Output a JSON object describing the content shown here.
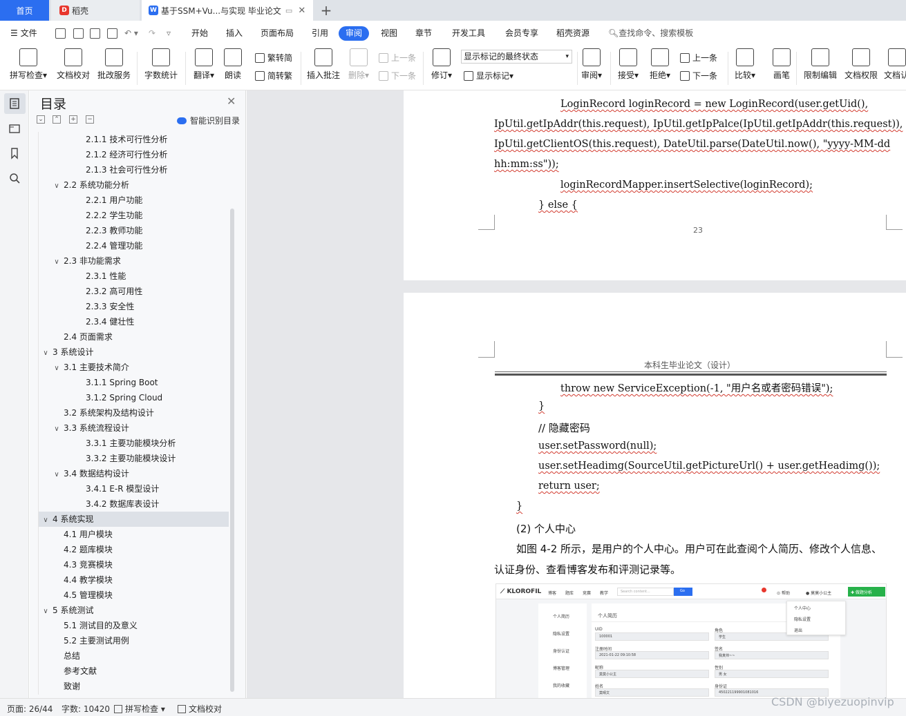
{
  "tabs": {
    "home": "首页",
    "docer": "稻壳",
    "doc": "基于SSM+Vu...与实现 毕业论文",
    "add": "+"
  },
  "menu": {
    "file": "文件",
    "items": [
      "开始",
      "插入",
      "页面布局",
      "引用",
      "审阅",
      "视图",
      "章节",
      "开发工具",
      "会员专享",
      "稻壳资源"
    ],
    "active": "审阅",
    "search": "查找命令、搜索模板"
  },
  "ribbon": {
    "spell": "拼写检查",
    "doc_check": "文档校对",
    "review_service": "批改服务",
    "word_count": "字数统计",
    "translate": "翻译",
    "read_aloud": "朗读",
    "to_traditional": "繁转简",
    "to_simplified": "简转繁",
    "insert_comment": "插入批注",
    "delete": "删除",
    "prev": "上一条",
    "next": "下一条",
    "revise": "修订",
    "markup_state": "显示标记的最终状态",
    "show_markup": "显示标记",
    "review": "审阅",
    "accept": "接受",
    "reject": "拒绝",
    "prev2": "上一条",
    "next2": "下一条",
    "compare": "比较",
    "ink": "画笔",
    "restrict_edit": "限制编辑",
    "doc_permission": "文档权限",
    "doc_more": "文档认"
  },
  "toc": {
    "title": "目录",
    "smart": "智能识别目录",
    "items": [
      {
        "text": "2.1.1 技术可行性分析",
        "level": 3,
        "arrow": ""
      },
      {
        "text": "2.1.2 经济可行性分析",
        "level": 3,
        "arrow": ""
      },
      {
        "text": "2.1.3 社会可行性分析",
        "level": 3,
        "arrow": ""
      },
      {
        "text": "2.2 系统功能分析",
        "level": 2,
        "arrow": "∨"
      },
      {
        "text": "2.2.1 用户功能",
        "level": 3,
        "arrow": ""
      },
      {
        "text": "2.2.2 学生功能",
        "level": 3,
        "arrow": ""
      },
      {
        "text": "2.2.3 教师功能",
        "level": 3,
        "arrow": ""
      },
      {
        "text": "2.2.4 管理功能",
        "level": 3,
        "arrow": ""
      },
      {
        "text": "2.3 非功能需求",
        "level": 2,
        "arrow": "∨"
      },
      {
        "text": "2.3.1 性能",
        "level": 3,
        "arrow": ""
      },
      {
        "text": "2.3.2 高可用性",
        "level": 3,
        "arrow": ""
      },
      {
        "text": "2.3.3 安全性",
        "level": 3,
        "arrow": ""
      },
      {
        "text": "2.3.4 健壮性",
        "level": 3,
        "arrow": ""
      },
      {
        "text": "2.4 页面需求",
        "level": 2,
        "arrow": ""
      },
      {
        "text": "3  系统设计",
        "level": 1,
        "arrow": "∨"
      },
      {
        "text": "3.1 主要技术简介",
        "level": 2,
        "arrow": "∨"
      },
      {
        "text": "3.1.1 Spring Boot",
        "level": 3,
        "arrow": ""
      },
      {
        "text": "3.1.2 Spring Cloud",
        "level": 3,
        "arrow": ""
      },
      {
        "text": "3.2 系统架构及结构设计",
        "level": 2,
        "arrow": ""
      },
      {
        "text": "3.3 系统流程设计",
        "level": 2,
        "arrow": "∨"
      },
      {
        "text": "3.3.1 主要功能模块分析",
        "level": 3,
        "arrow": ""
      },
      {
        "text": "3.3.2 主要功能模块设计",
        "level": 3,
        "arrow": ""
      },
      {
        "text": "3.4 数据结构设计",
        "level": 2,
        "arrow": "∨"
      },
      {
        "text": "3.4.1 E-R 模型设计",
        "level": 3,
        "arrow": ""
      },
      {
        "text": "3.4.2 数据库表设计",
        "level": 3,
        "arrow": ""
      },
      {
        "text": "4  系统实现",
        "level": 1,
        "arrow": "∨",
        "selected": true
      },
      {
        "text": "4.1 用户模块",
        "level": 2,
        "arrow": ""
      },
      {
        "text": "4.2 题库模块",
        "level": 2,
        "arrow": ""
      },
      {
        "text": "4.3 竞赛模块",
        "level": 2,
        "arrow": ""
      },
      {
        "text": "4.4 教学模块",
        "level": 2,
        "arrow": ""
      },
      {
        "text": "4.5 管理模块",
        "level": 2,
        "arrow": ""
      },
      {
        "text": "5  系统测试",
        "level": 1,
        "arrow": "∨"
      },
      {
        "text": "5.1 测试目的及意义",
        "level": 2,
        "arrow": ""
      },
      {
        "text": "5.2 主要测试用例",
        "level": 2,
        "arrow": ""
      },
      {
        "text": "总结",
        "level": 0,
        "arrow": ""
      },
      {
        "text": "参考文献",
        "level": 0,
        "arrow": ""
      },
      {
        "text": "致谢",
        "level": 0,
        "arrow": ""
      }
    ]
  },
  "page1": {
    "lines": [
      "LoginRecord loginRecord = new LoginRecord(user.getUid(),",
      "IpUtil.getIpAddr(this.request), IpUtil.getIpPalce(IpUtil.getIpAddr(this.request)),",
      "IpUtil.getClientOS(this.request), DateUtil.parse(DateUtil.now(), \"yyyy-MM-dd",
      "hh:mm:ss\"));",
      "loginRecordMapper.insertSelective(loginRecord);",
      "} else {"
    ],
    "page_number": "23"
  },
  "page2": {
    "header": "本科生毕业论文（设计）",
    "lines": [
      "throw new ServiceException(-1, \"用户名或者密码错误\");",
      "}",
      "//  隐藏密码",
      "user.setPassword(null);",
      "user.setHeadimg(SourceUtil.getPictureUrl() + user.getHeadimg());",
      "return user;",
      "}",
      "(2) 个人中心",
      "如图 4-2 所示，是用户的个人中心。用户可在此查阅个人简历、修改个人信息、",
      "认证身份、查看博客发布和评测记录等。"
    ]
  },
  "screenshot": {
    "logo": "KLOROFIL",
    "nav": [
      "博客",
      "题库",
      "竞赛",
      "教学"
    ],
    "search_placeholder": "Search content...",
    "go": "Go",
    "help": "帮助",
    "user": "莫莫小公主",
    "analysis": "✚ 做题分析",
    "side": [
      "个人简历",
      "隐私设置",
      "身份认证",
      "博客管理",
      "我的收藏"
    ],
    "main_title": "个人简历",
    "fields": [
      {
        "label": "UID",
        "value": "100001"
      },
      {
        "label": "角色",
        "value": "学生"
      },
      {
        "label": "注册时间",
        "value": "2021-01-22 09:10:58"
      },
      {
        "label": "签名",
        "value": "我真帅~~"
      },
      {
        "label": "昵称",
        "value": "莫莫小公主"
      },
      {
        "label": "性别",
        "value": "男    女"
      },
      {
        "label": "姓名",
        "value": "莫晴文"
      },
      {
        "label": "身份证",
        "value": "450221199901081016"
      }
    ],
    "popup": [
      "个人中心",
      "隐私设置",
      "退出"
    ]
  },
  "status": {
    "page": "页面: 26/44",
    "words": "字数: 10420",
    "spell": "拼写检查",
    "proof": "文档校对"
  },
  "watermark": "CSDN @biyezuopinvip",
  "colors": {
    "accent": "#2b6ef0",
    "green": "#27b14a",
    "spell_underline": "#d23b2f"
  }
}
